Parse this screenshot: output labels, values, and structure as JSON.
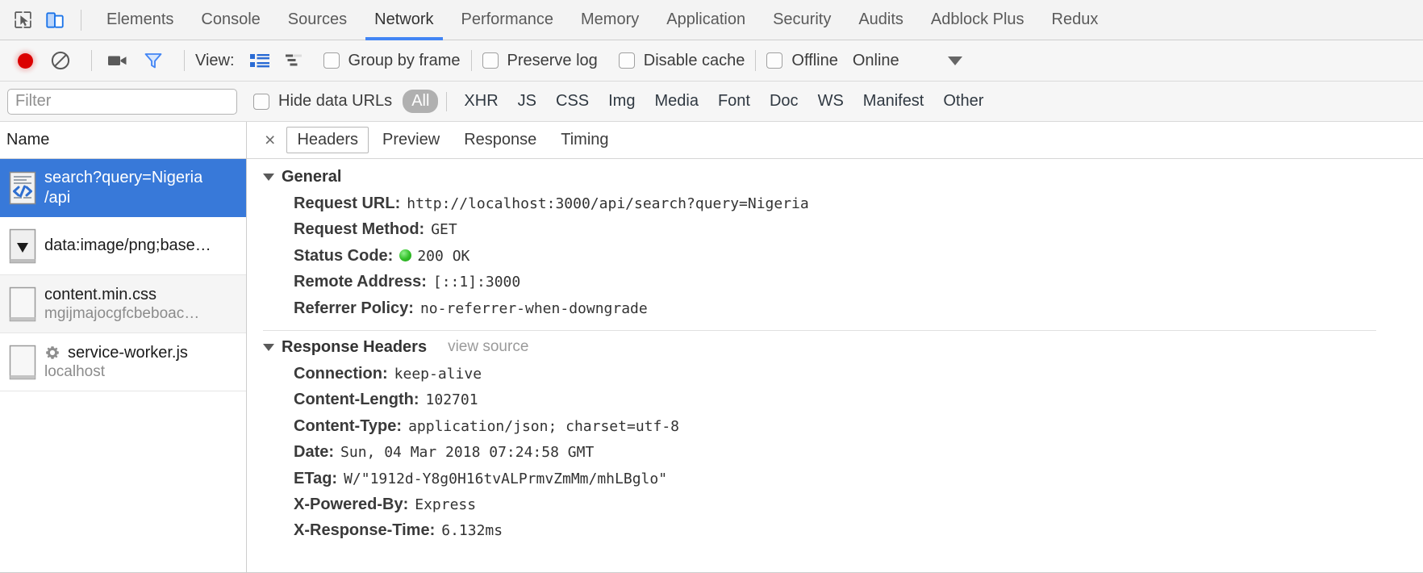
{
  "tabbar": {
    "inspect_icon": "inspect-cursor-icon",
    "device_icon": "device-toolbar-icon",
    "tabs": [
      {
        "label": "Elements",
        "active": false
      },
      {
        "label": "Console",
        "active": false
      },
      {
        "label": "Sources",
        "active": false
      },
      {
        "label": "Network",
        "active": true
      },
      {
        "label": "Performance",
        "active": false
      },
      {
        "label": "Memory",
        "active": false
      },
      {
        "label": "Application",
        "active": false
      },
      {
        "label": "Security",
        "active": false
      },
      {
        "label": "Audits",
        "active": false
      },
      {
        "label": "Adblock Plus",
        "active": false
      },
      {
        "label": "Redux",
        "active": false
      }
    ]
  },
  "controlbar": {
    "record_icon": "record-button-icon",
    "clear_icon": "clear-icon",
    "capture_screenshots_icon": "camera-icon",
    "filter_icon": "funnel-icon",
    "view_label": "View:",
    "view_list_icon": "list-view-icon",
    "view_waterfall_icon": "waterfall-view-icon",
    "group_by_frame": {
      "label": "Group by frame",
      "checked": false
    },
    "preserve_log": {
      "label": "Preserve log",
      "checked": false
    },
    "disable_cache": {
      "label": "Disable cache",
      "checked": false
    },
    "offline": {
      "label": "Offline",
      "checked": false
    },
    "throttling": {
      "value": "Online",
      "caret_icon": "chevron-down-icon"
    }
  },
  "filterbar": {
    "filter_placeholder": "Filter",
    "filter_value": "",
    "hide_data_urls": {
      "label": "Hide data URLs",
      "checked": false
    },
    "types": [
      {
        "label": "All",
        "selected": true
      },
      {
        "label": "XHR",
        "selected": false
      },
      {
        "label": "JS",
        "selected": false
      },
      {
        "label": "CSS",
        "selected": false
      },
      {
        "label": "Img",
        "selected": false
      },
      {
        "label": "Media",
        "selected": false
      },
      {
        "label": "Font",
        "selected": false
      },
      {
        "label": "Doc",
        "selected": false
      },
      {
        "label": "WS",
        "selected": false
      },
      {
        "label": "Manifest",
        "selected": false
      },
      {
        "label": "Other",
        "selected": false
      }
    ]
  },
  "requestlist": {
    "column_header": "Name",
    "rows": [
      {
        "name": "search?query=Nigeria",
        "sub": "/api",
        "icon": "xhr-document-icon",
        "selected": true,
        "alt": false,
        "gear": false
      },
      {
        "name": "data:image/png;base…",
        "sub": "",
        "icon": "image-thumbnail-icon",
        "selected": false,
        "alt": false,
        "gear": false
      },
      {
        "name": "content.min.css",
        "sub": "mgijmajocgfcbeboac…",
        "icon": "stylesheet-icon",
        "selected": false,
        "alt": true,
        "gear": false
      },
      {
        "name": "service-worker.js",
        "sub": "localhost",
        "icon": "script-icon",
        "selected": false,
        "alt": false,
        "gear": true
      }
    ]
  },
  "detail": {
    "close_label": "×",
    "tabs": [
      {
        "label": "Headers",
        "active": true
      },
      {
        "label": "Preview",
        "active": false
      },
      {
        "label": "Response",
        "active": false
      },
      {
        "label": "Timing",
        "active": false
      }
    ],
    "general": {
      "title": "General",
      "rows": [
        {
          "key": "Request URL:",
          "value": "http://localhost:3000/api/search?query=Nigeria",
          "status": false
        },
        {
          "key": "Request Method:",
          "value": "GET",
          "status": false
        },
        {
          "key": "Status Code:",
          "value": "200 OK",
          "status": true
        },
        {
          "key": "Remote Address:",
          "value": "[::1]:3000",
          "status": false
        },
        {
          "key": "Referrer Policy:",
          "value": "no-referrer-when-downgrade",
          "status": false
        }
      ]
    },
    "response_headers": {
      "title": "Response Headers",
      "view_source": "view source",
      "rows": [
        {
          "key": "Connection:",
          "value": "keep-alive"
        },
        {
          "key": "Content-Length:",
          "value": "102701"
        },
        {
          "key": "Content-Type:",
          "value": "application/json; charset=utf-8"
        },
        {
          "key": "Date:",
          "value": "Sun, 04 Mar 2018 07:24:58 GMT"
        },
        {
          "key": "ETag:",
          "value": "W/\"1912d-Y8g0H16tvALPrmvZmMm/mhLBglo\""
        },
        {
          "key": "X-Powered-By:",
          "value": "Express"
        },
        {
          "key": "X-Response-Time:",
          "value": "6.132ms"
        }
      ]
    }
  },
  "colors": {
    "accent": "#4285f4",
    "selection": "#3879d9",
    "record_red": "#db0000",
    "status_green": "#34c12a"
  }
}
